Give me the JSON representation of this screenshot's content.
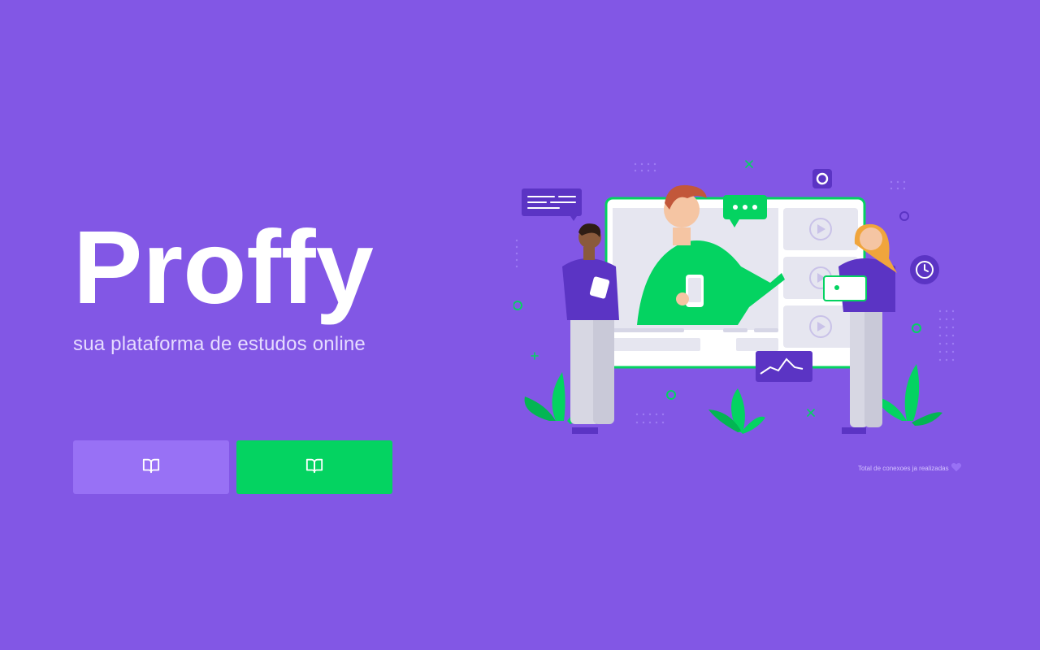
{
  "app": {
    "logo_text": "Proffy",
    "tagline": "sua plataforma de estudos online"
  },
  "actions": {
    "study_label": "",
    "give_classes_label": ""
  },
  "footer": {
    "connections_text": "Total de conexoes ja realizadas"
  },
  "icons": {
    "study": "book-open-icon",
    "give_classes": "book-open-icon",
    "connections": "purple-heart-icon"
  },
  "colors": {
    "background": "#8257e5",
    "primary_light": "#9871f5",
    "secondary": "#04d361",
    "tagline": "#e6dcff"
  }
}
